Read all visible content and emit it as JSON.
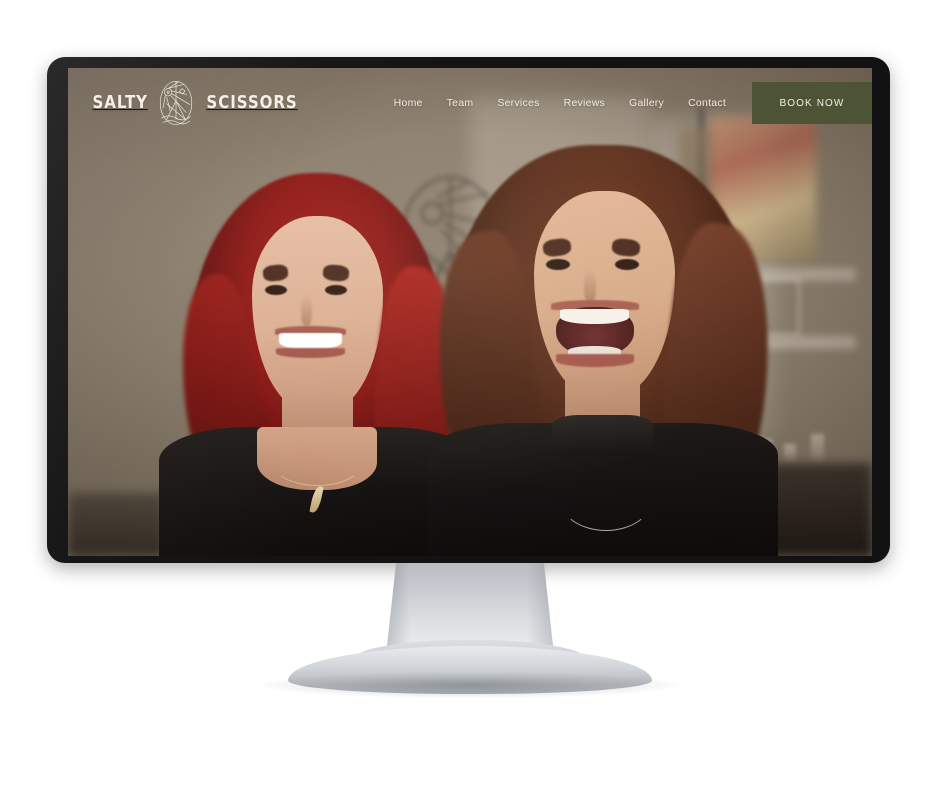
{
  "mockup": {
    "device": "desktop-monitor",
    "bezel_color": "#121212",
    "stand_color": "#c9ccd1"
  },
  "site": {
    "brand": {
      "word_left": "SALTY",
      "word_right": "SCISSORS",
      "emblem_icon": "oval-sunburst-scissors-waves-emblem",
      "color": "#f4efe7"
    },
    "nav": {
      "items": [
        {
          "label": "Home"
        },
        {
          "label": "Team"
        },
        {
          "label": "Services"
        },
        {
          "label": "Reviews"
        },
        {
          "label": "Gallery"
        },
        {
          "label": "Contact"
        }
      ]
    },
    "cta": {
      "label": "BOOK NOW",
      "background": "#4d5436",
      "text_color": "#f3f0e8"
    },
    "hero": {
      "description": "Two smiling hairstylists in a salon",
      "background_color": "#8b7e6d",
      "wall_art_icon": "scissors-sunburst-wall-art",
      "subjects": [
        {
          "position": "left",
          "hair": "red",
          "hair_color": "#8d1714",
          "top": "black square-neck top",
          "necklace": "gold pendant chain",
          "expression": "smiling"
        },
        {
          "position": "right",
          "hair": "auburn brown wavy",
          "hair_color": "#5a2e1b",
          "top": "black mock-neck top",
          "necklace": "silver chain",
          "expression": "laughing"
        }
      ]
    }
  }
}
